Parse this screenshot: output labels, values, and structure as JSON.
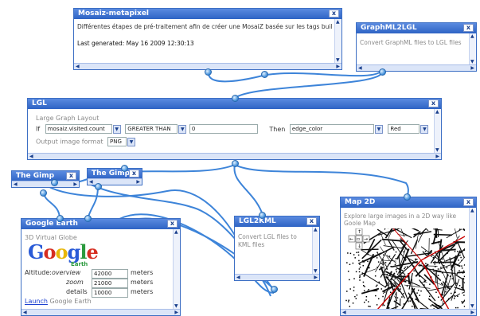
{
  "colors": {
    "titlebar": "#2e63c4",
    "wire": "#3d84d9",
    "link": "#1a3fd0",
    "red_line": "#cc0000"
  },
  "mosaiz": {
    "title": "Mosaiz-metapixel",
    "description": "Différentes étapes de pré-traitement afin de créer une MosaiZ basée sur les tags buildings",
    "generated": "Last generated: May 16 2009 12:30:13"
  },
  "graphml": {
    "title": "GraphML2LGL",
    "description": "Convert GraphML files to LGL files"
  },
  "lgl": {
    "title": "LGL",
    "subtitle": "Large Graph Layout",
    "if_label": "If",
    "field_value": "mosaiz.visited.count",
    "operator_value": "GREATER THAN",
    "threshold_value": "0",
    "then_label": "Then",
    "then_value": "edge_color",
    "color_value": "Red",
    "minus_button": "-",
    "output_label": "Output image format",
    "output_value": "PNG"
  },
  "gimp1": {
    "title": "The Gimp"
  },
  "gimp2": {
    "title": "The Gimp"
  },
  "google_earth": {
    "title": "Google Earth",
    "subtitle": "3D Virtual Globe",
    "logo_letters": [
      "G",
      "o",
      "o",
      "g",
      "l",
      "e"
    ],
    "logo_sub": "Earth",
    "altitude_label": "Altitude:",
    "overview_label": "overview",
    "overview_value": "42000",
    "zoom_label": "zoom",
    "zoom_value": "21000",
    "details_label": "details",
    "details_value": "10000",
    "unit": "meters",
    "launch_link": "Launch",
    "launch_rest": " Google Earth"
  },
  "lgl2kml": {
    "title": "LGL2KML",
    "description": "Convert LGL files to KML files"
  },
  "map2d": {
    "title": "Map 2D",
    "description": "Explore large images in a 2D way like Goole Map"
  },
  "close_glyph": "x"
}
